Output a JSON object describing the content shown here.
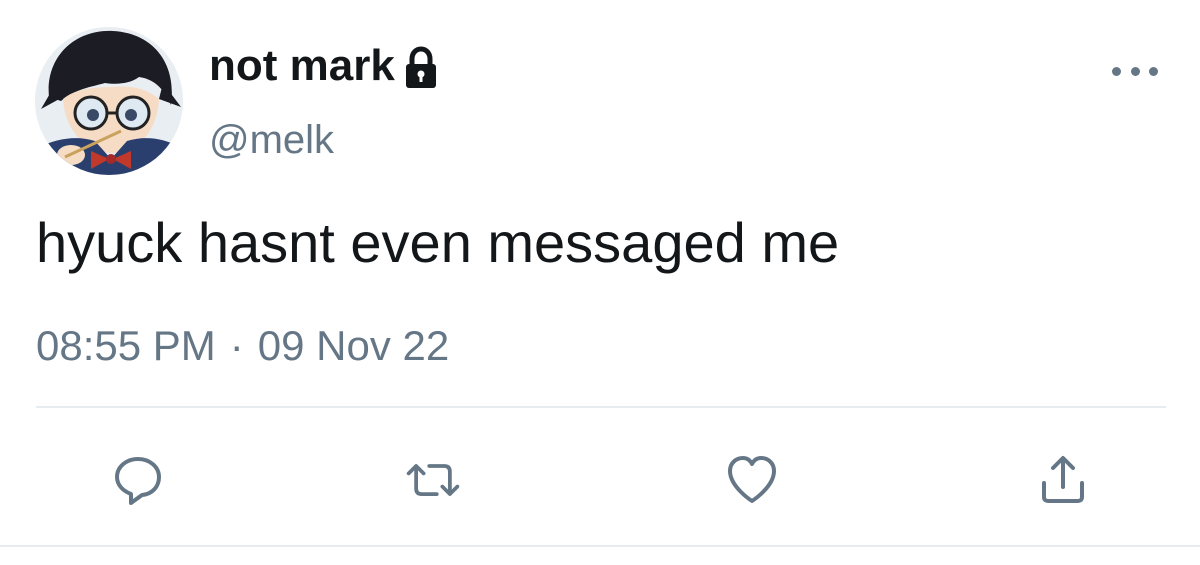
{
  "author": {
    "display_name": "not mark",
    "handle": "@melk",
    "protected_icon": "lock-icon",
    "avatar": "avatar"
  },
  "tweet": {
    "text": "hyuck hasnt even messaged me",
    "time": "08:55 PM",
    "separator": "·",
    "date": "09 Nov 22"
  },
  "actions": [
    {
      "icon": "reply-icon"
    },
    {
      "icon": "retweet-icon"
    },
    {
      "icon": "like-icon"
    },
    {
      "icon": "share-icon"
    }
  ],
  "menu": {
    "icon": "more-options-icon"
  },
  "colors": {
    "primary_text": "#14171a",
    "secondary_text": "#657786",
    "divider": "#e6ecf0",
    "background": "#ffffff"
  }
}
